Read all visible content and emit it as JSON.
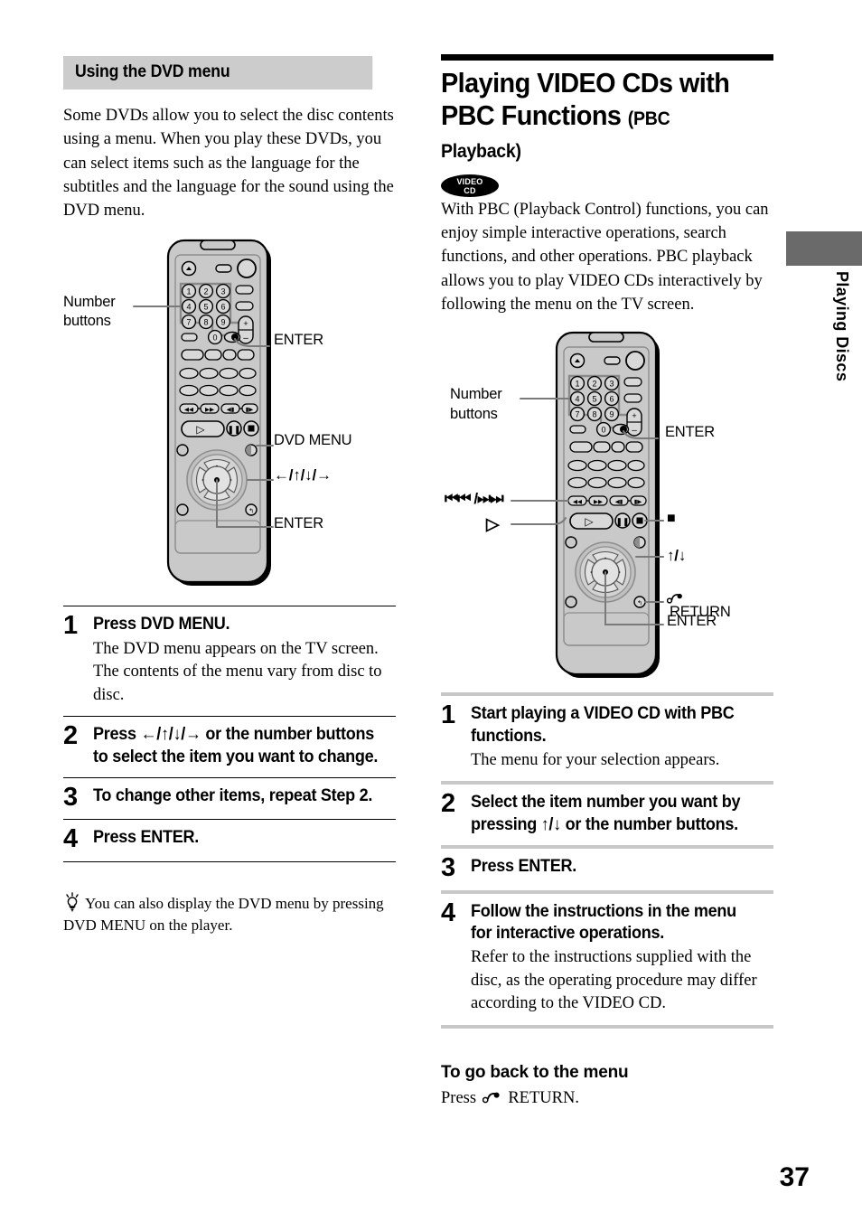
{
  "page": {
    "number": "37",
    "side_tab_label": "Playing Discs"
  },
  "left_column": {
    "section_heading": "Using the DVD menu",
    "intro": "Some DVDs allow you to select the disc contents using a menu. When you play these DVDs, you can select items such as the language for the subtitles and the language for the sound using the DVD menu.",
    "figure": {
      "name": "dvd-remote-control",
      "labels": {
        "number_buttons": "Number\nbuttons",
        "number_buttons_l1": "Number",
        "number_buttons_l2": "buttons",
        "enter_top": "ENTER",
        "dvd_menu": "DVD MENU",
        "arrows": "←/↑/↓/→",
        "enter_bottom": "ENTER"
      },
      "keypad_digits": [
        "1",
        "2",
        "3",
        "4",
        "5",
        "6",
        "7",
        "8",
        "9",
        "0"
      ],
      "volume_plus": "+",
      "volume_minus": "–"
    },
    "steps": [
      {
        "num": "1",
        "title": "Press DVD MENU.",
        "desc": "The DVD menu appears on the TV screen. The contents of the menu vary from disc to disc."
      },
      {
        "num": "2",
        "title": "Press ←/↑/↓/→ or the number buttons to select the item you want to change.",
        "desc": ""
      },
      {
        "num": "3",
        "title": "To change other items, repeat Step 2.",
        "desc": ""
      },
      {
        "num": "4",
        "title": "Press ENTER.",
        "desc": ""
      }
    ],
    "tip": {
      "icon": "lightbulb-icon",
      "text": "You can also display the DVD menu by pressing DVD MENU on the player."
    }
  },
  "right_column": {
    "title_line1": "Playing VIDEO CDs with",
    "title_line2": "PBC Functions",
    "title_suffix": "(PBC Playback)",
    "badge": {
      "line1": "VIDEO",
      "line2": "CD"
    },
    "intro": "With PBC (Playback Control) functions, you can enjoy simple interactive operations, search functions, and other operations. PBC playback allows you to play VIDEO CDs interactively by following the menu on the TV screen.",
    "figure": {
      "name": "vcd-remote-control",
      "labels": {
        "number_buttons_l1": "Number",
        "number_buttons_l2": "buttons",
        "enter_top": "ENTER",
        "skip": "⏮⏮ /⏭⏭",
        "play": "▷",
        "stop": "■",
        "up_down": "↑/↓",
        "return": "RETURN",
        "enter_bottom": "ENTER"
      },
      "keypad_digits": [
        "1",
        "2",
        "3",
        "4",
        "5",
        "6",
        "7",
        "8",
        "9",
        "0"
      ],
      "volume_plus": "+",
      "volume_minus": "–"
    },
    "steps": [
      {
        "num": "1",
        "title": "Start playing a VIDEO CD with PBC functions.",
        "desc": "The menu for your selection appears."
      },
      {
        "num": "2",
        "title": "Select the item number you want by pressing ↑/↓ or the number buttons.",
        "desc": ""
      },
      {
        "num": "3",
        "title": "Press ENTER.",
        "desc": ""
      },
      {
        "num": "4",
        "title": "Follow the instructions in the menu for interactive operations.",
        "desc": "Refer to the instructions supplied with the disc, as the operating procedure may differ according to the VIDEO CD."
      }
    ],
    "back_section": {
      "heading": "To go back to the menu",
      "text_before": "Press",
      "text_after": "RETURN."
    }
  },
  "colors": {
    "heading_band": "#cccccc",
    "divider_gray": "#c8c8c8",
    "side_tab": "#6a6a6a",
    "remote_body": "#c9c9c9",
    "remote_button": "#d8d8d8"
  }
}
